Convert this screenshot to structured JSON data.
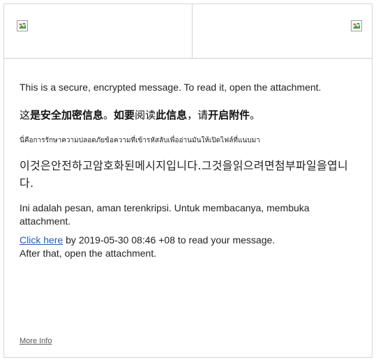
{
  "header": {
    "left_image_icon": "broken-image-icon",
    "right_image_icon": "broken-image-icon"
  },
  "message": {
    "english": "This is a secure, encrypted message. To read it, open the attachment.",
    "chinese_parts": [
      {
        "text": "这",
        "bold": false
      },
      {
        "text": "是安全加密信息",
        "bold": true
      },
      {
        "text": "。",
        "bold": false
      },
      {
        "text": "如要",
        "bold": true
      },
      {
        "text": "阅读",
        "bold": false
      },
      {
        "text": "此信息",
        "bold": true
      },
      {
        "text": "，",
        "bold": false
      },
      {
        "text": "请",
        "bold": false
      },
      {
        "text": "开启附件",
        "bold": true
      },
      {
        "text": "。",
        "bold": false
      }
    ],
    "thai": "นี่คือการรักษาความปลอดภัยข้อความที่เข้ารหัสลับเพื่ออ่านมันให้เปิดไฟล์ที่แนบมา",
    "korean": "이것은안전하고암호화된메시지입니다.그것을읽으려면첨부파일을엽니다.",
    "indonesian": "Ini adalah pesan, aman terenkripsi. Untuk membacanya, membuka attachment.",
    "link_text": "Click here",
    "link_suffix": " by 2019-05-30 08:46 +08 to read your message.",
    "after_line": "After that, open the attachment."
  },
  "footer": {
    "more_info": "More Info"
  }
}
